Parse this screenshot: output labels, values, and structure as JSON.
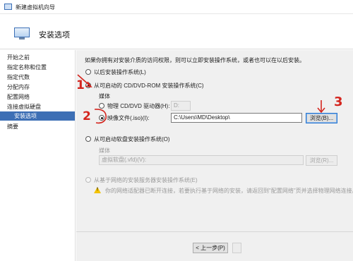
{
  "window": {
    "title": "新建虚拟机向导"
  },
  "header": {
    "title": "安装选项"
  },
  "sidebar": {
    "items": [
      {
        "label": "开始之前"
      },
      {
        "label": "指定名称和位置"
      },
      {
        "label": "指定代数"
      },
      {
        "label": "分配内存"
      },
      {
        "label": "配置网络"
      },
      {
        "label": "连接虚拟硬盘"
      },
      {
        "label": "安装选项"
      },
      {
        "label": "摘要"
      }
    ],
    "active": "安装选项"
  },
  "main": {
    "intro": "如果你拥有对安装介质的访问权限，则可以立即安装操作系统，或者也可以在以后安装。",
    "opt_later": "以后安装操作系统(L)",
    "opt_cd": "从可启动的 CD/DVD-ROM 安装操作系统(C)",
    "media_label": "媒体",
    "opt_physical": "物理 CD/DVD 驱动器(H):",
    "drive_value": "D:",
    "opt_image": "映像文件(.iso)(I):",
    "iso_path": "C:\\Users\\MD\\Desktop\\",
    "browse_label": "浏览(B)...",
    "opt_floppy": "从可启动软盘安装操作系统(O)",
    "media_label_2": "媒体",
    "vfd_placeholder": "虚拟软盘(.vfd)(V):",
    "browse_label_2": "浏览(R)...",
    "opt_network": "从基于网络的安装服务器安装操作系统(E)",
    "network_warning": "你的网络适配器已断开连接，若要执行基于网络的安装，请返回到\"配置网络\"页并选择物理网络连接。"
  },
  "footer": {
    "prev_label": "< 上一步(P)"
  },
  "annotations": {
    "one": "1",
    "two": "2",
    "three": "3"
  }
}
